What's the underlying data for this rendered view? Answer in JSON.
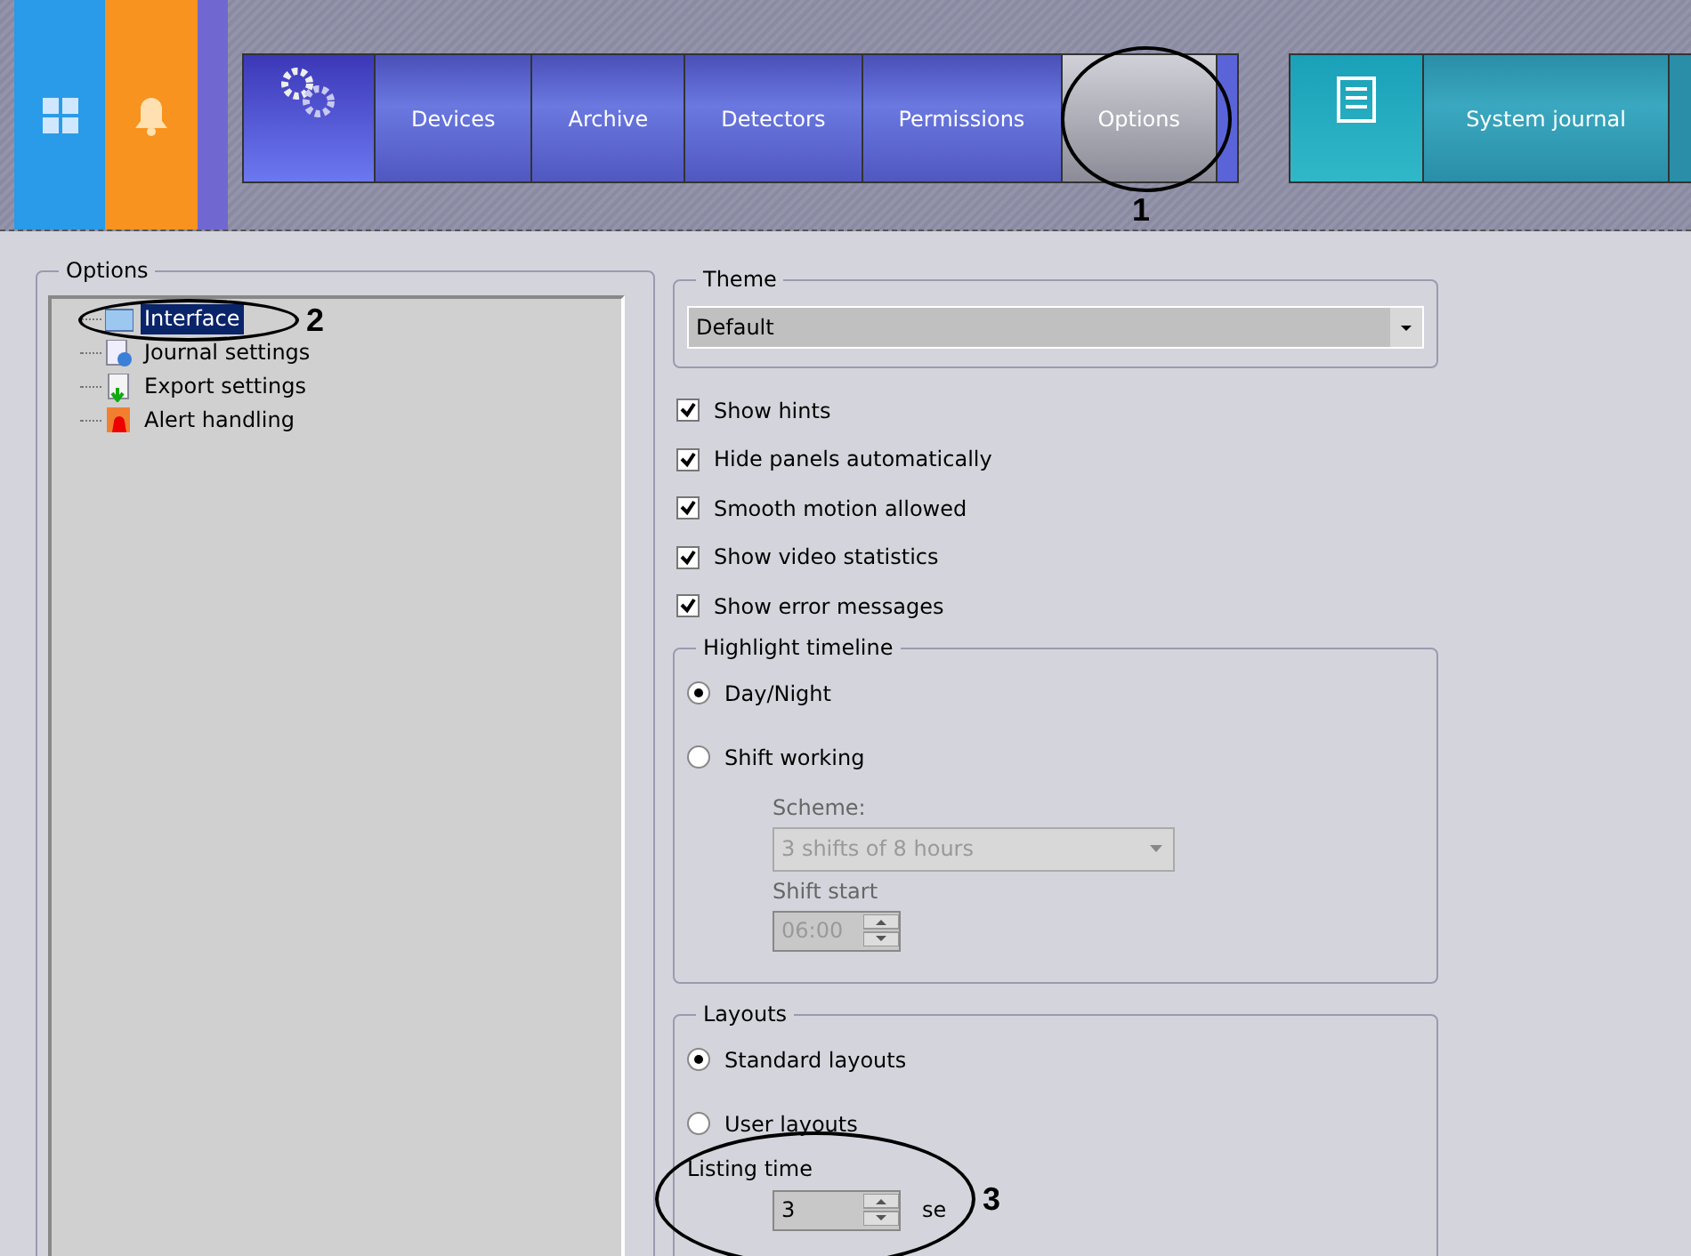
{
  "menu": {
    "tabs": [
      {
        "label": "Devices",
        "selected": false
      },
      {
        "label": "Archive",
        "selected": false
      },
      {
        "label": "Detectors",
        "selected": false
      },
      {
        "label": "Permissions",
        "selected": false
      },
      {
        "label": "Options",
        "selected": true
      }
    ],
    "journal": {
      "label": "System journal"
    }
  },
  "options_panel": {
    "title": "Options",
    "tree": [
      {
        "kind": "interface",
        "label": "Interface",
        "selected": true
      },
      {
        "kind": "journal",
        "label": "Journal settings",
        "selected": false
      },
      {
        "kind": "export",
        "label": "Export settings",
        "selected": false
      },
      {
        "kind": "alert",
        "label": "Alert handling",
        "selected": false
      }
    ]
  },
  "settings": {
    "theme": {
      "title": "Theme",
      "value": "Default"
    },
    "checkboxes": [
      {
        "label": "Show hints",
        "checked": true
      },
      {
        "label": "Hide panels automatically",
        "checked": true
      },
      {
        "label": "Smooth motion allowed",
        "checked": true
      },
      {
        "label": "Show video statistics",
        "checked": true
      },
      {
        "label": "Show error messages",
        "checked": true
      }
    ],
    "highlight_timeline": {
      "title": "Highlight timeline",
      "options": [
        {
          "label": "Day/Night",
          "selected": true
        },
        {
          "label": "Shift working",
          "selected": false
        }
      ],
      "scheme": {
        "label": "Scheme:",
        "value": "3 shifts of 8 hours",
        "disabled": true
      },
      "shift_start": {
        "label": "Shift start",
        "value": "06:00",
        "disabled": true
      }
    },
    "layouts": {
      "title": "Layouts",
      "options": [
        {
          "label": "Standard layouts",
          "selected": true
        },
        {
          "label": "User layouts",
          "selected": false
        }
      ],
      "listing_time": {
        "label": "Listing time",
        "value": "3",
        "unit": "se"
      }
    }
  },
  "annotations": [
    {
      "label": "1"
    },
    {
      "label": "2"
    },
    {
      "label": "3"
    }
  ]
}
